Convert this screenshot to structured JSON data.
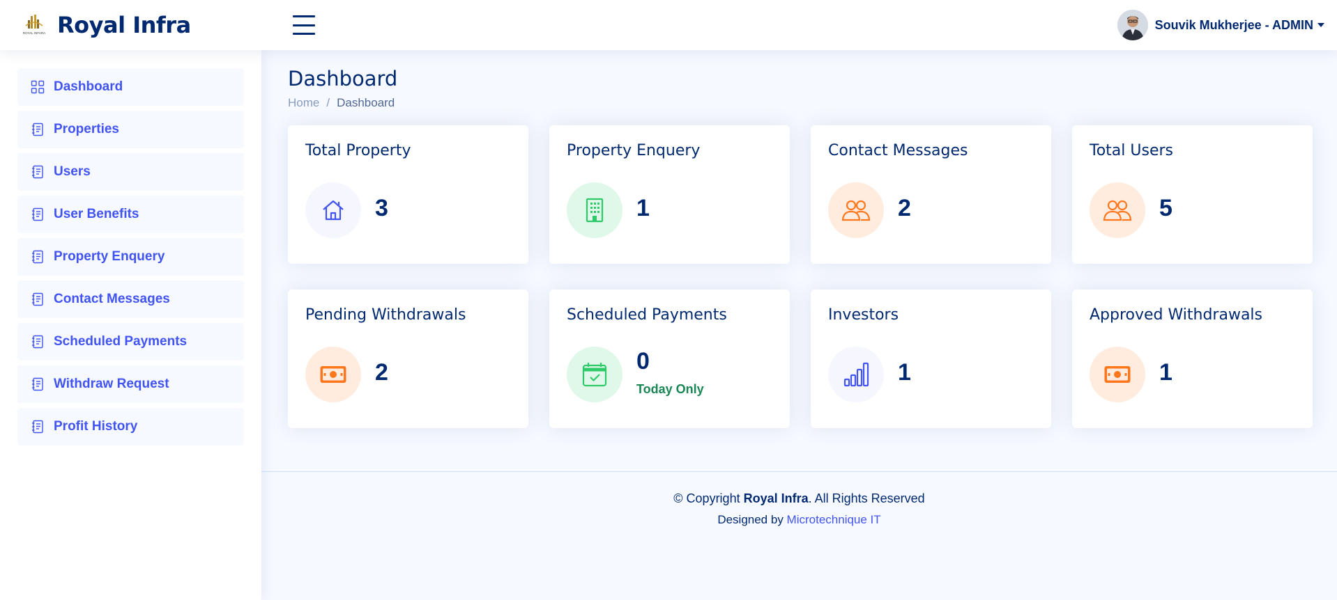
{
  "header": {
    "brand": "Royal Infra",
    "logo_caption": "ROYAL INFARA",
    "user_name": "Souvik Mukherjee - ADMIN"
  },
  "sidebar": {
    "items": [
      {
        "label": "Dashboard",
        "icon": "grid-icon"
      },
      {
        "label": "Properties",
        "icon": "journal-text-icon"
      },
      {
        "label": "Users",
        "icon": "journal-text-icon"
      },
      {
        "label": "User Benefits",
        "icon": "journal-text-icon"
      },
      {
        "label": "Property Enquery",
        "icon": "journal-text-icon"
      },
      {
        "label": "Contact Messages",
        "icon": "journal-text-icon"
      },
      {
        "label": "Scheduled Payments",
        "icon": "journal-text-icon"
      },
      {
        "label": "Withdraw Request",
        "icon": "journal-text-icon"
      },
      {
        "label": "Profit History",
        "icon": "journal-text-icon"
      }
    ]
  },
  "main": {
    "title": "Dashboard",
    "breadcrumb": {
      "home": "Home",
      "separator": "/",
      "current": "Dashboard"
    },
    "cards": [
      {
        "title": "Total Property",
        "value": "3",
        "icon": "house-icon",
        "color": "#4154f1"
      },
      {
        "title": "Property Enquery",
        "value": "1",
        "icon": "building-icon",
        "color": "#2eca6a"
      },
      {
        "title": "Contact Messages",
        "value": "2",
        "icon": "people-icon",
        "color": "#ff771d"
      },
      {
        "title": "Total Users",
        "value": "5",
        "icon": "people-icon",
        "color": "#ff771d"
      },
      {
        "title": "Pending Withdrawals",
        "value": "2",
        "icon": "cash-icon",
        "color": "#ff771d"
      },
      {
        "title": "Scheduled Payments",
        "value": "0",
        "subtitle": "Today Only",
        "icon": "calendar-check-icon",
        "color": "#2eca6a"
      },
      {
        "title": "Investors",
        "value": "1",
        "icon": "bar-chart-icon",
        "color": "#4154f1"
      },
      {
        "title": "Approved Withdrawals",
        "value": "1",
        "icon": "cash-icon",
        "color": "#ff771d"
      }
    ]
  },
  "footer": {
    "copyright_prefix": "© Copyright ",
    "copyright_brand": "Royal Infra",
    "copyright_suffix": ". All Rights Reserved",
    "designed_by": "Designed by ",
    "designer": "Microtechnique IT"
  }
}
